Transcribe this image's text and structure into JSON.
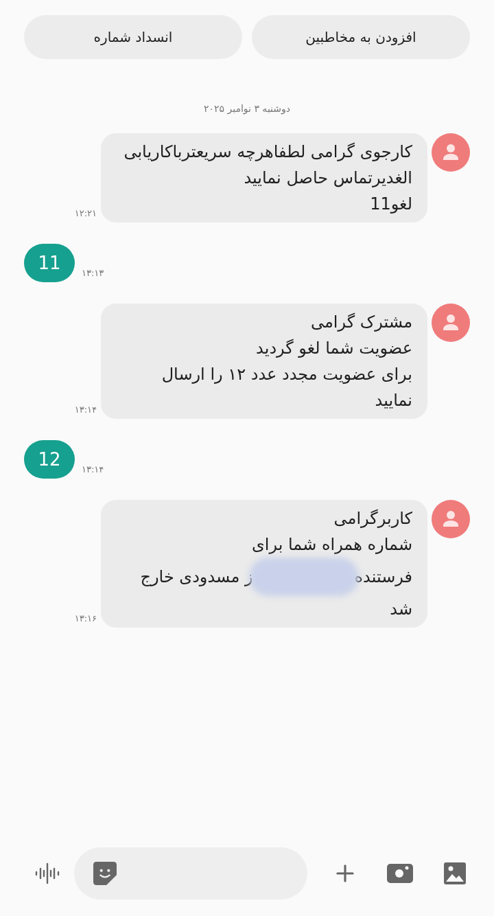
{
  "actions": [
    {
      "label": "افزودن به مخاطبین"
    },
    {
      "label": "انسداد شماره"
    }
  ],
  "date": "دوشنبه ۳ نوامبر ۲۰۲۵",
  "messages": [
    {
      "kind": "received",
      "lines": [
        "کارجوی گرامی لطفاهرچه سریعترباکاریابی",
        "الغدیرتماس حاصل نمایید",
        "لغو11"
      ],
      "time": "۱۲:۲۱"
    },
    {
      "kind": "sent",
      "lines": [
        "11"
      ],
      "time": "۱۳:۱۳"
    },
    {
      "kind": "received",
      "lines": [
        "مشترک گرامی",
        "عضویت شما لغو گردید",
        "برای عضویت مجدد عدد ۱۲ را ارسال",
        "نمایید"
      ],
      "time": "۱۳:۱۴"
    },
    {
      "kind": "sent",
      "lines": [
        "12"
      ],
      "time": "۱۳:۱۴"
    },
    {
      "kind": "received",
      "lines": [
        "کاربرگرامی",
        "شماره همراه شما برای",
        [
          "فرستنده",
          "ز مسدودی خارج"
        ],
        "شد"
      ],
      "time": "۱۳:۱۶"
    }
  ]
}
